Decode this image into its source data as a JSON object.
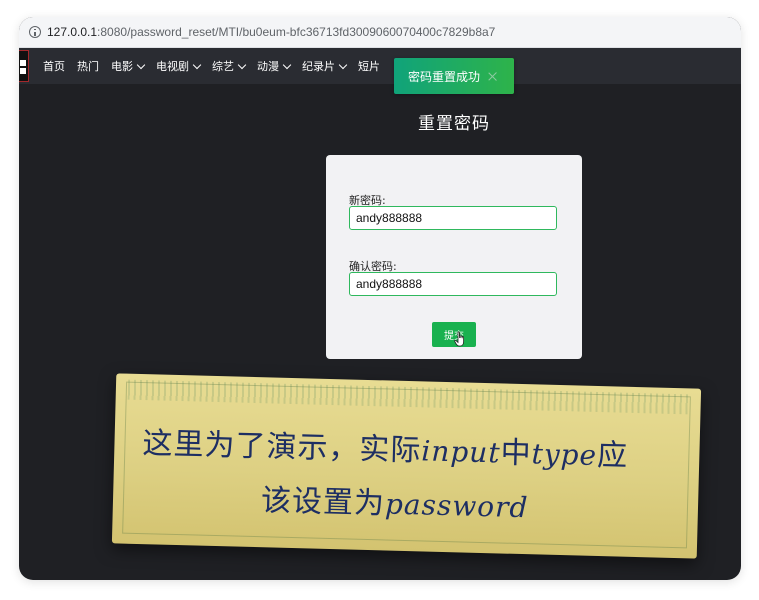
{
  "browser": {
    "url_host": "127.0.0.1",
    "url_path": ":8080/password_reset/MTI/bu0eum-bfc36713fd3009060070400c7829b8a7"
  },
  "nav": {
    "items": [
      {
        "label": "首页",
        "has_dropdown": false
      },
      {
        "label": "热门",
        "has_dropdown": false
      },
      {
        "label": "电影",
        "has_dropdown": true
      },
      {
        "label": "电视剧",
        "has_dropdown": true
      },
      {
        "label": "综艺",
        "has_dropdown": true
      },
      {
        "label": "动漫",
        "has_dropdown": true
      },
      {
        "label": "纪录片",
        "has_dropdown": true
      },
      {
        "label": "短片",
        "has_dropdown": false
      }
    ]
  },
  "toast": {
    "message": "密码重置成功"
  },
  "page": {
    "title": "重置密码"
  },
  "form": {
    "new_password_label": "新密码:",
    "new_password_value": "andy888888",
    "confirm_password_label": "确认密码:",
    "confirm_password_value": "andy888888",
    "submit_label": "提交"
  },
  "annotation": {
    "line1_a": "这里为了演示，实际",
    "line1_b": "input",
    "line1_c": "中",
    "line1_d": "type",
    "line1_e": "应",
    "line2_a": "该设置为",
    "line2_b": "password"
  },
  "colors": {
    "accent_green": "#19b14f",
    "toast_start": "#10a37a",
    "navbar_bg": "#2a2c32",
    "page_bg": "#1f2024"
  }
}
